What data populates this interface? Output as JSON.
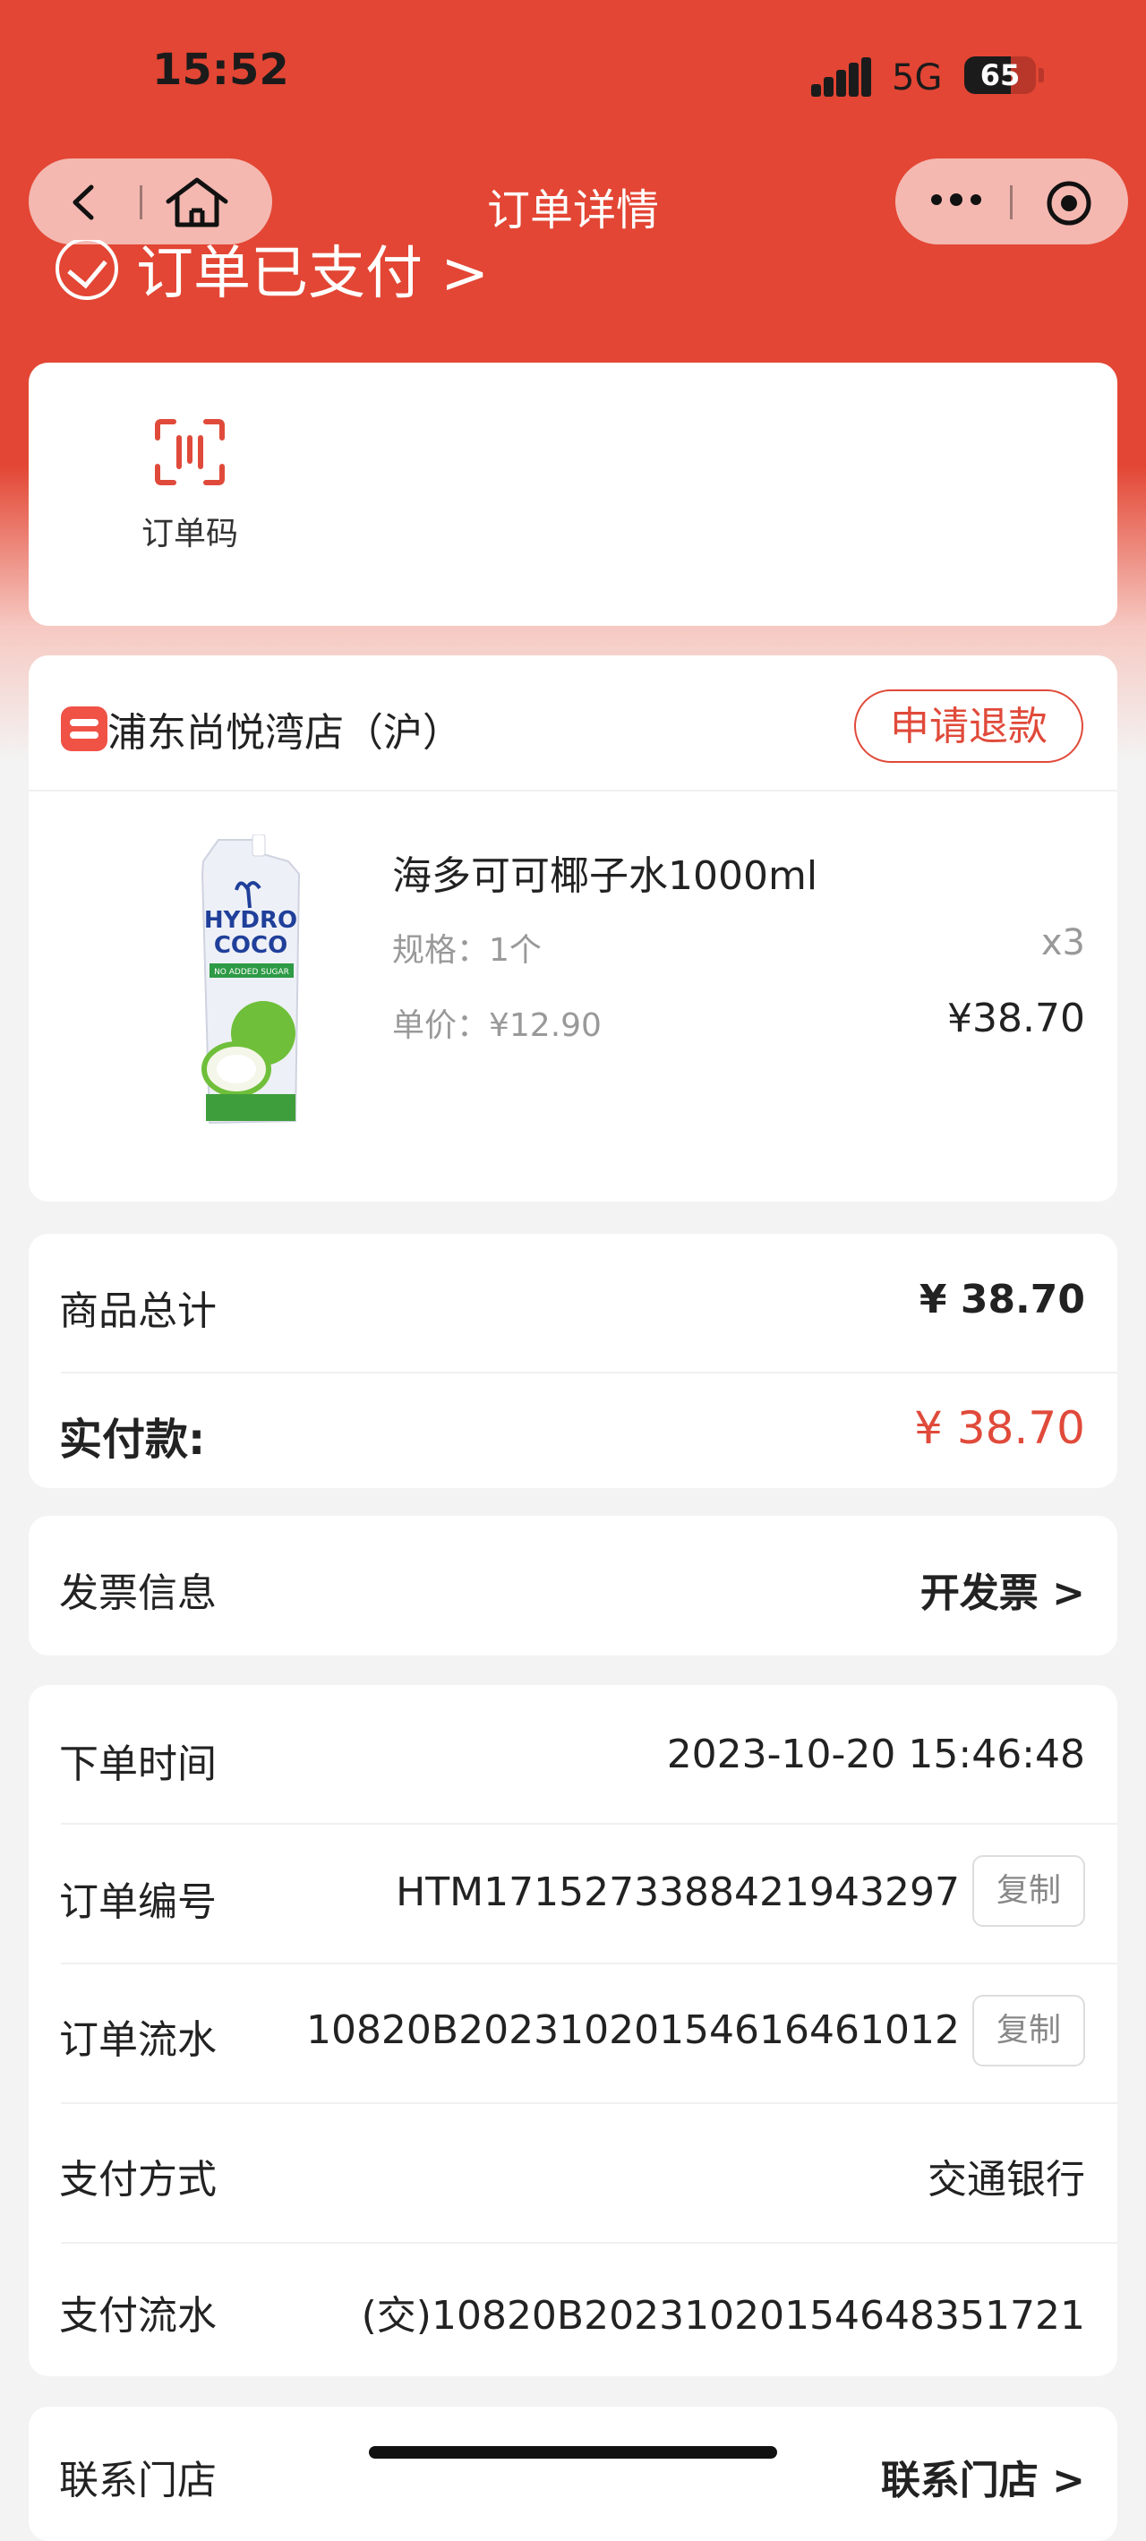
{
  "status_bar": {
    "time": "15:52",
    "network": "5G",
    "battery": "65",
    "battery_level": 0.65
  },
  "navbar": {
    "title": "订单详情"
  },
  "order_status": {
    "text": "订单已支付 >"
  },
  "order_code": {
    "label": "订单码"
  },
  "store": {
    "name": "浦东尚悦湾店（沪）",
    "refund_label": "申请退款"
  },
  "product": {
    "name": "海多可可椰子水1000ml",
    "spec": "规格：1个",
    "qty": "x3",
    "unit_price": "单价：¥12.90",
    "total": "¥38.70",
    "image_text": {
      "brand1": "HYDRO",
      "brand2": "COCO",
      "tag": "NO ADDED SUGAR"
    }
  },
  "summary": {
    "goods_label": "商品总计",
    "goods_value": "¥ 38.70",
    "paid_label": "实付款:",
    "paid_value": "¥ 38.70"
  },
  "invoice": {
    "label": "发票信息",
    "action": "开发票 >"
  },
  "info": [
    {
      "label": "下单时间",
      "value": "2023-10-20 15:46:48",
      "copy": ""
    },
    {
      "label": "订单编号",
      "value": "HTM1715273388421943297",
      "copy": "复制"
    },
    {
      "label": "订单流水",
      "value": "10820B20231020154616461012",
      "copy": "复制"
    },
    {
      "label": "支付方式",
      "value": "交通银行",
      "copy": ""
    },
    {
      "label": "支付流水",
      "value": "(交)10820B20231020154648351721",
      "copy": ""
    }
  ],
  "contact": {
    "label": "联系门店",
    "action": "联系门店 >"
  },
  "colors": {
    "brand_red": "#e34634",
    "accent_red": "#e04a3a"
  }
}
